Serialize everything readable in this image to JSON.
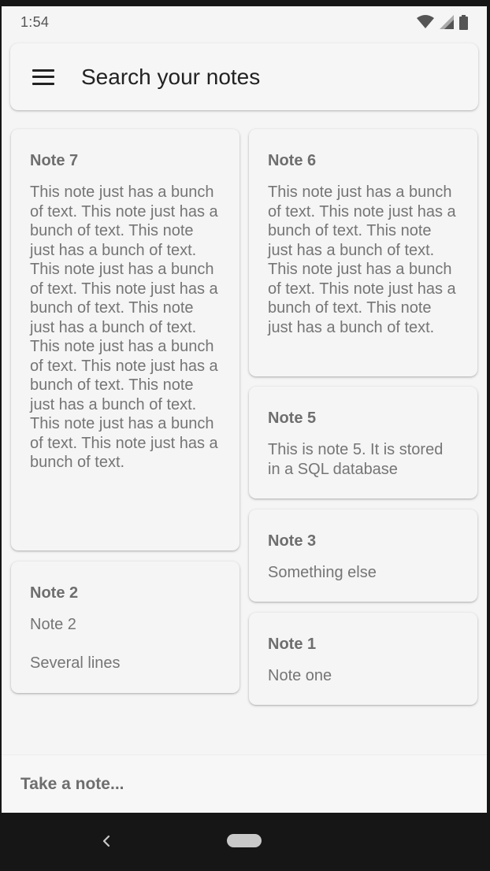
{
  "status_bar": {
    "time": "1:54",
    "icons": [
      "wifi-icon",
      "cell-signal-icon",
      "battery-icon"
    ]
  },
  "search": {
    "menu_icon": "hamburger-menu-icon",
    "title": "Search your notes"
  },
  "notes": {
    "note7": {
      "title": "Note 7",
      "body": "This note just has a bunch of text. This note just has a bunch of text. This note just has a bunch of text. This note just has a bunch of text. This note just has a bunch of text. This note just has a bunch of text. This note just has a bunch of text. This note just has a bunch of text. This note just has a bunch of text. This note just has a bunch of text. This note just has a bunch of text."
    },
    "note6": {
      "title": "Note 6",
      "body": "This note just has a bunch of text. This note just has a bunch of text. This note just has a bunch of text. This note just has a bunch of text. This note just has a bunch of text. This note just has a bunch of text."
    },
    "note5": {
      "title": "Note 5",
      "body": "This is note 5. It is stored in a SQL database"
    },
    "note3": {
      "title": "Note 3",
      "body": "Something else"
    },
    "note2": {
      "title": "Note 2",
      "body": "Note 2\n\nSeveral lines"
    },
    "note1": {
      "title": "Note 1",
      "body": "Note one"
    }
  },
  "footer": {
    "take_note_label": "Take a note..."
  },
  "nav_bar": {
    "icons": [
      "back-icon",
      "home-pill-icon"
    ]
  },
  "colors": {
    "background": "#f5f5f5",
    "card_text": "#757575",
    "title_text": "#222222",
    "system_bar": "#161616"
  }
}
